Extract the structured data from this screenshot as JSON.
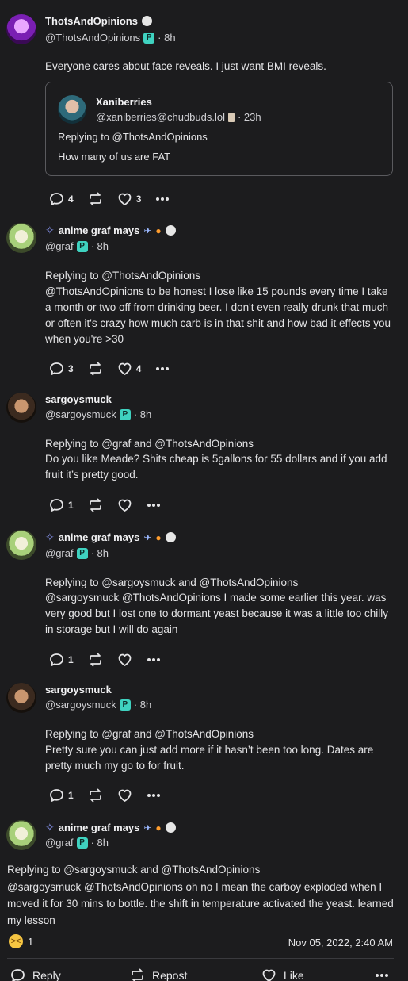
{
  "posts": [
    {
      "name": "ThotsAndOpinions",
      "handle": "@ThotsAndOpinions",
      "time": "· 8h",
      "text": "Everyone cares about face reveals. I just want BMI reveals.",
      "quote": {
        "name": "Xaniberries",
        "handle": "@xaniberries@chudbuds.lol",
        "time": "· 23h",
        "replying": "Replying to @ThotsAndOpinions",
        "text": "How many of us are FAT"
      },
      "replies": "4",
      "likes": "3"
    },
    {
      "name": "anime graf mays",
      "handle": "@graf",
      "time": "· 8h",
      "replying": "Replying to @ThotsAndOpinions",
      "text": "@ThotsAndOpinions to be honest I lose like 15 pounds every time I take a month or two off from drinking beer. I don't even really drunk that much or often it's crazy how much carb is in that shit and how bad it effects you when you're >30",
      "replies": "3",
      "likes": "4"
    },
    {
      "name": "sargoysmuck",
      "handle": "@sargoysmuck",
      "time": "· 8h",
      "replying": "Replying to @graf and @ThotsAndOpinions",
      "text": "Do you like Meade? Shits cheap is 5gallons for 55 dollars and if you add fruit it’s pretty good.",
      "replies": "1"
    },
    {
      "name": "anime graf mays",
      "handle": "@graf",
      "time": "· 8h",
      "replying": "Replying to @sargoysmuck and @ThotsAndOpinions",
      "text": "@sargoysmuck @ThotsAndOpinions I made some earlier this year. was very good but I lost one to dormant yeast because it was a little too chilly in storage but I will do again",
      "replies": "1"
    },
    {
      "name": "sargoysmuck",
      "handle": "@sargoysmuck",
      "time": "· 8h",
      "replying": "Replying to @graf and @ThotsAndOpinions",
      "text": "Pretty sure you can just add more if it hasn’t been too long. Dates are pretty much my go to for fruit.",
      "replies": "1"
    },
    {
      "name": "anime graf mays",
      "handle": "@graf",
      "time": "· 8h",
      "replying": "Replying to @sargoysmuck and @ThotsAndOpinions",
      "text": "@sargoysmuck @ThotsAndOpinions oh no I mean the carboy exploded when I moved it for 30 mins to bottle. the shift in temperature activated the yeast. learned my lesson",
      "reaction_count": "1",
      "timestamp": "Nov 05, 2022, 2:40 AM"
    }
  ],
  "bottom_bar": {
    "reply": "Reply",
    "repost": "Repost",
    "like": "Like"
  },
  "icons": [
    "reply-icon",
    "repost-icon",
    "heart-icon",
    "more-icon",
    "ai-sparkle-icon",
    "satellite-icon",
    "planet-icon",
    "weary-face-icon"
  ]
}
